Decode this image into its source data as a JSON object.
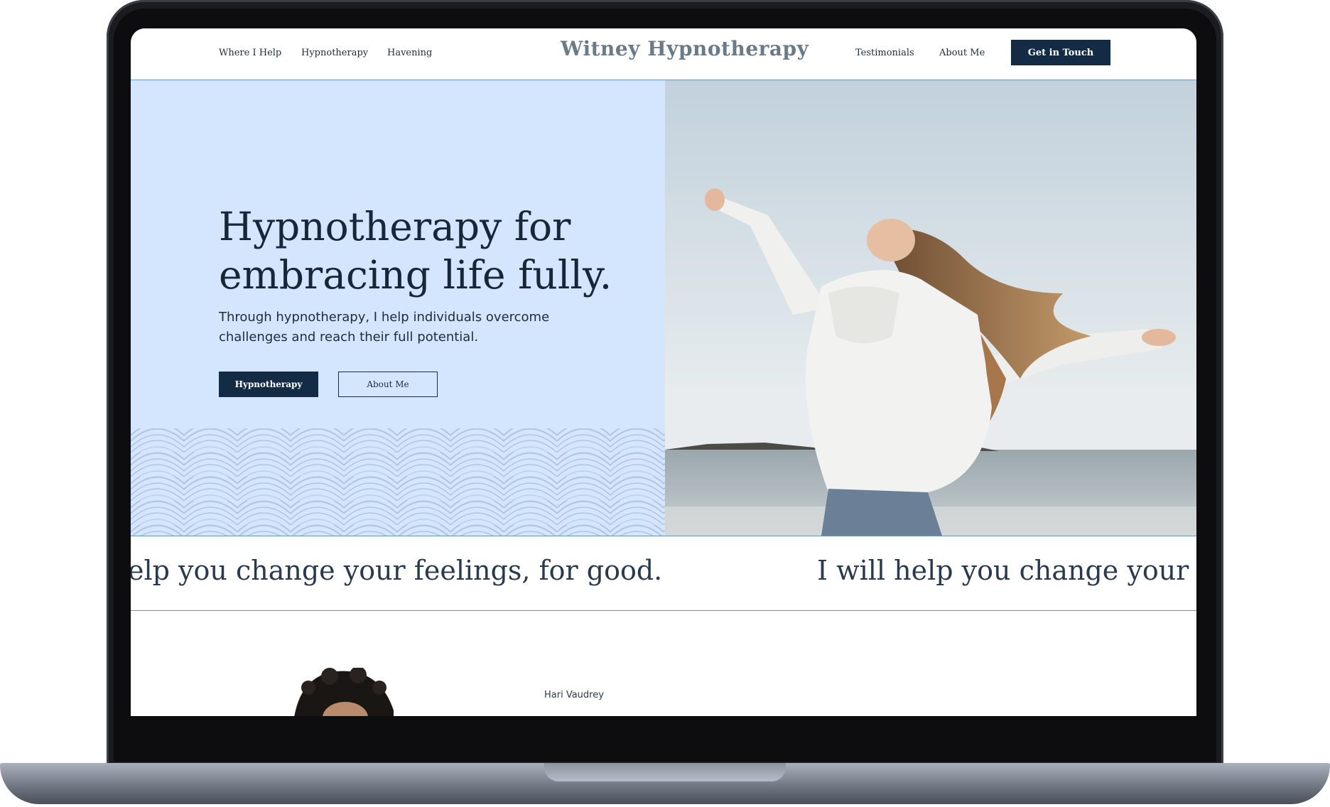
{
  "header": {
    "nav_left": [
      "Where I Help",
      "Hypnotherapy",
      "Havening"
    ],
    "logo": "Witney Hypnotherapy",
    "nav_right": [
      "Testimonials",
      "About Me"
    ],
    "cta": "Get in Touch"
  },
  "hero": {
    "title_line1": "Hypnotherapy for",
    "title_line2": "embracing life fully.",
    "subtitle_line1": "Through hypnotherapy, I help individuals overcome",
    "subtitle_line2": "challenges and reach their full potential.",
    "primary_button": "Hypnotherapy",
    "secondary_button": "About Me"
  },
  "marquee": {
    "segment1": "elp you change your feelings, for good.",
    "segment2": "I will help you change your fee"
  },
  "about": {
    "name": "Hari Vaudrey"
  },
  "colors": {
    "navy": "#132b45",
    "hero_bg": "#d3e6fd",
    "divider": "#6f95b5"
  }
}
